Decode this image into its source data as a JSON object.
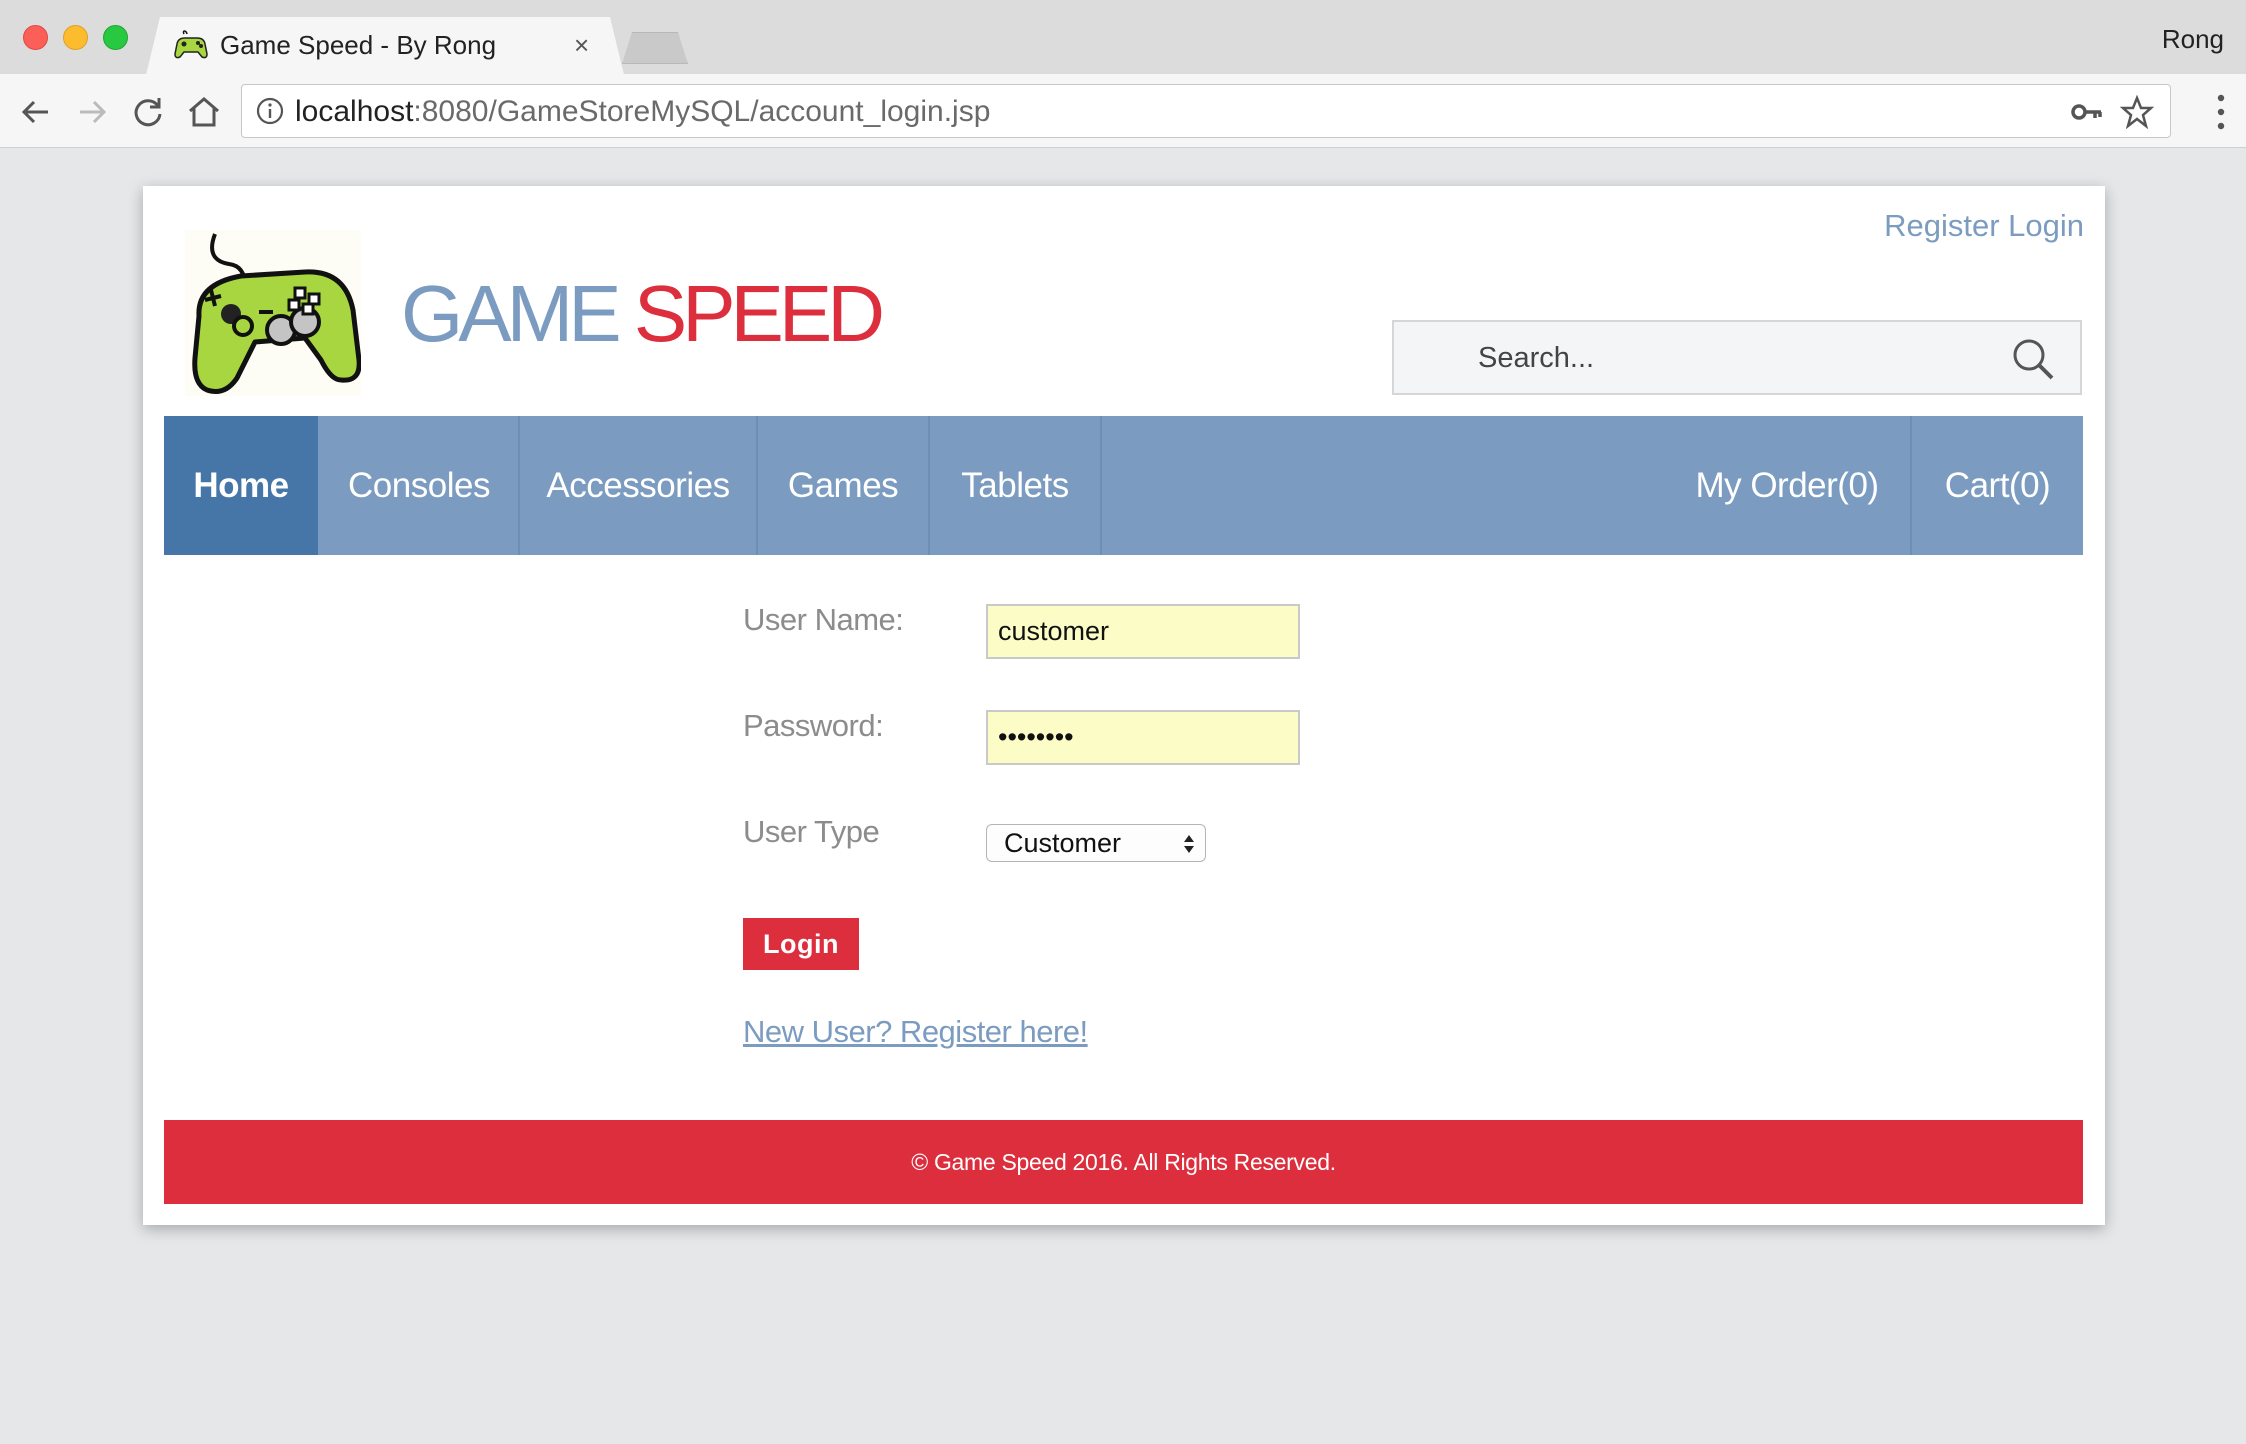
{
  "browser": {
    "tab_title": "Game Speed - By Rong",
    "tab_close": "×",
    "profile_name": "Rong",
    "url_host": "localhost",
    "url_rest": ":8080/GameStoreMySQL/account_login.jsp"
  },
  "site": {
    "brand_game": "GAME",
    "brand_speed": "SPEED",
    "top_links": {
      "register": "Register",
      "login": "Login"
    },
    "search": {
      "placeholder": "Search..."
    },
    "nav": {
      "items": [
        "Home",
        "Consoles",
        "Accessories",
        "Games",
        "Tablets"
      ],
      "right_items": [
        "My Order(0)",
        "Cart(0)"
      ],
      "active": "Home"
    },
    "colors": {
      "accent_blue": "#7b9cc0",
      "active_blue": "#4676a8",
      "brand_red": "#dc2e3d",
      "input_yellow": "#fbfcc6"
    }
  },
  "login_form": {
    "username_label": "User Name:",
    "username_value": "customer",
    "password_label": "Password:",
    "password_value": "••••••••",
    "user_type_label": "User Type",
    "user_type_value": "Customer",
    "login_button": "Login",
    "register_link": "New User? Register here!"
  },
  "footer": {
    "text": "© Game Speed 2016. All Rights Reserved."
  }
}
